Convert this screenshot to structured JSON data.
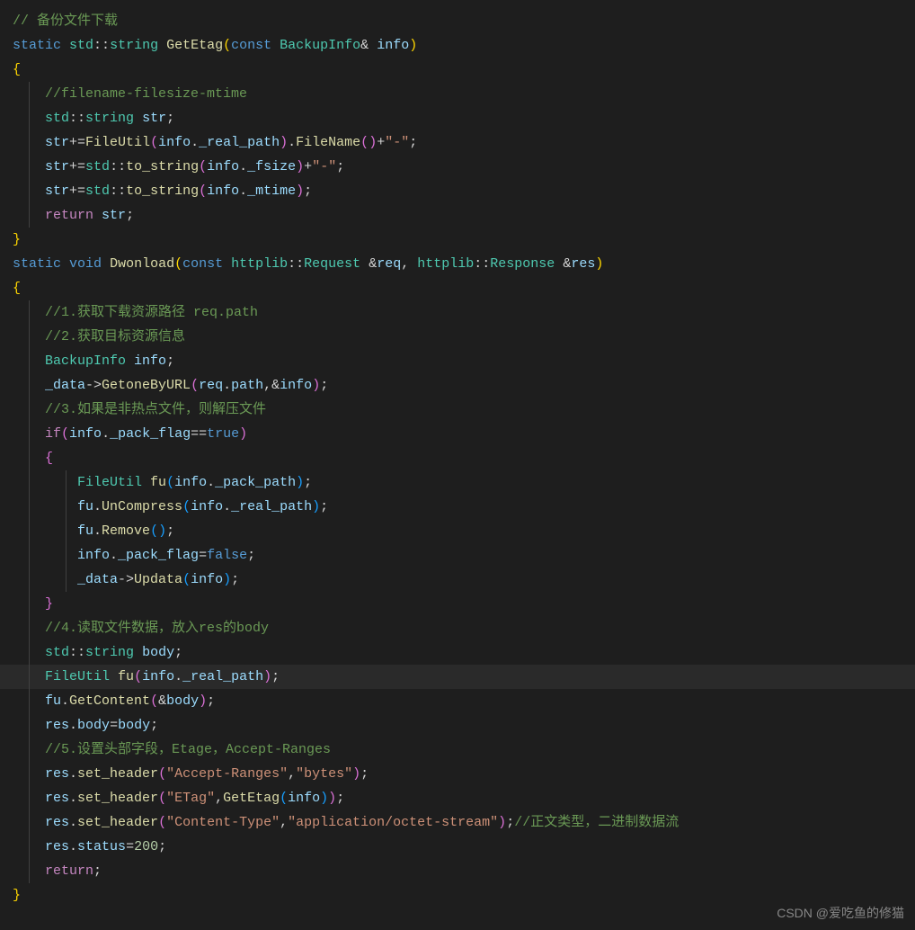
{
  "watermark": "CSDN @爱吃鱼的修猫",
  "lines": [
    {
      "indent": 0,
      "guides": [],
      "tokens": [
        {
          "t": "// ",
          "c": "c-comment"
        },
        {
          "t": "备份文件下载",
          "c": "c-comment"
        }
      ]
    },
    {
      "indent": 0,
      "guides": [],
      "tokens": [
        {
          "t": "static",
          "c": "c-keyword"
        },
        {
          "t": " ",
          "c": ""
        },
        {
          "t": "std",
          "c": "c-ns"
        },
        {
          "t": "::",
          "c": "c-punct"
        },
        {
          "t": "string",
          "c": "c-ns"
        },
        {
          "t": " ",
          "c": ""
        },
        {
          "t": "GetEtag",
          "c": "c-func"
        },
        {
          "t": "(",
          "c": "c-brace"
        },
        {
          "t": "const",
          "c": "c-keyword"
        },
        {
          "t": " ",
          "c": ""
        },
        {
          "t": "BackupInfo",
          "c": "c-type"
        },
        {
          "t": "&",
          "c": "c-op"
        },
        {
          "t": " ",
          "c": ""
        },
        {
          "t": "info",
          "c": "c-var"
        },
        {
          "t": ")",
          "c": "c-brace"
        }
      ]
    },
    {
      "indent": 0,
      "guides": [],
      "tokens": [
        {
          "t": "{",
          "c": "c-brace"
        }
      ]
    },
    {
      "indent": 1,
      "guides": [
        1
      ],
      "tokens": [
        {
          "t": "//filename-filesize-mtime",
          "c": "c-comment"
        }
      ]
    },
    {
      "indent": 1,
      "guides": [
        1
      ],
      "tokens": [
        {
          "t": "std",
          "c": "c-ns"
        },
        {
          "t": "::",
          "c": "c-punct"
        },
        {
          "t": "string",
          "c": "c-ns"
        },
        {
          "t": " ",
          "c": ""
        },
        {
          "t": "str",
          "c": "c-var"
        },
        {
          "t": ";",
          "c": "c-punct"
        }
      ]
    },
    {
      "indent": 1,
      "guides": [
        1
      ],
      "tokens": [
        {
          "t": "str",
          "c": "c-var"
        },
        {
          "t": "+=",
          "c": "c-op"
        },
        {
          "t": "FileUtil",
          "c": "c-func"
        },
        {
          "t": "(",
          "c": "c-brace2"
        },
        {
          "t": "info",
          "c": "c-var"
        },
        {
          "t": ".",
          "c": "c-punct"
        },
        {
          "t": "_real_path",
          "c": "c-var"
        },
        {
          "t": ")",
          "c": "c-brace2"
        },
        {
          "t": ".",
          "c": "c-punct"
        },
        {
          "t": "FileName",
          "c": "c-func"
        },
        {
          "t": "(",
          "c": "c-brace2"
        },
        {
          "t": ")",
          "c": "c-brace2"
        },
        {
          "t": "+",
          "c": "c-op"
        },
        {
          "t": "\"-\"",
          "c": "c-string"
        },
        {
          "t": ";",
          "c": "c-punct"
        }
      ]
    },
    {
      "indent": 1,
      "guides": [
        1
      ],
      "tokens": [
        {
          "t": "str",
          "c": "c-var"
        },
        {
          "t": "+=",
          "c": "c-op"
        },
        {
          "t": "std",
          "c": "c-ns"
        },
        {
          "t": "::",
          "c": "c-punct"
        },
        {
          "t": "to_string",
          "c": "c-func"
        },
        {
          "t": "(",
          "c": "c-brace2"
        },
        {
          "t": "info",
          "c": "c-var"
        },
        {
          "t": ".",
          "c": "c-punct"
        },
        {
          "t": "_fsize",
          "c": "c-var"
        },
        {
          "t": ")",
          "c": "c-brace2"
        },
        {
          "t": "+",
          "c": "c-op"
        },
        {
          "t": "\"-\"",
          "c": "c-string"
        },
        {
          "t": ";",
          "c": "c-punct"
        }
      ]
    },
    {
      "indent": 1,
      "guides": [
        1
      ],
      "tokens": [
        {
          "t": "str",
          "c": "c-var"
        },
        {
          "t": "+=",
          "c": "c-op"
        },
        {
          "t": "std",
          "c": "c-ns"
        },
        {
          "t": "::",
          "c": "c-punct"
        },
        {
          "t": "to_string",
          "c": "c-func"
        },
        {
          "t": "(",
          "c": "c-brace2"
        },
        {
          "t": "info",
          "c": "c-var"
        },
        {
          "t": ".",
          "c": "c-punct"
        },
        {
          "t": "_mtime",
          "c": "c-var"
        },
        {
          "t": ")",
          "c": "c-brace2"
        },
        {
          "t": ";",
          "c": "c-punct"
        }
      ]
    },
    {
      "indent": 1,
      "guides": [
        1
      ],
      "tokens": [
        {
          "t": "return",
          "c": "c-ctrl"
        },
        {
          "t": " ",
          "c": ""
        },
        {
          "t": "str",
          "c": "c-var"
        },
        {
          "t": ";",
          "c": "c-punct"
        }
      ]
    },
    {
      "indent": 0,
      "guides": [],
      "tokens": [
        {
          "t": "}",
          "c": "c-brace"
        }
      ]
    },
    {
      "indent": 0,
      "guides": [],
      "tokens": [
        {
          "t": "static",
          "c": "c-keyword"
        },
        {
          "t": " ",
          "c": ""
        },
        {
          "t": "void",
          "c": "c-keyword"
        },
        {
          "t": " ",
          "c": ""
        },
        {
          "t": "Dwonload",
          "c": "c-func"
        },
        {
          "t": "(",
          "c": "c-brace"
        },
        {
          "t": "const",
          "c": "c-keyword"
        },
        {
          "t": " ",
          "c": ""
        },
        {
          "t": "httplib",
          "c": "c-ns"
        },
        {
          "t": "::",
          "c": "c-punct"
        },
        {
          "t": "Request",
          "c": "c-type"
        },
        {
          "t": " ",
          "c": ""
        },
        {
          "t": "&",
          "c": "c-op"
        },
        {
          "t": "req",
          "c": "c-var"
        },
        {
          "t": ",",
          "c": "c-punct"
        },
        {
          "t": " ",
          "c": ""
        },
        {
          "t": "httplib",
          "c": "c-ns"
        },
        {
          "t": "::",
          "c": "c-punct"
        },
        {
          "t": "Response",
          "c": "c-type"
        },
        {
          "t": " ",
          "c": ""
        },
        {
          "t": "&",
          "c": "c-op"
        },
        {
          "t": "res",
          "c": "c-var"
        },
        {
          "t": ")",
          "c": "c-brace"
        }
      ]
    },
    {
      "indent": 0,
      "guides": [],
      "tokens": [
        {
          "t": "{",
          "c": "c-brace"
        }
      ]
    },
    {
      "indent": 1,
      "guides": [
        1
      ],
      "tokens": [
        {
          "t": "//1.获取下载资源路径 req.path",
          "c": "c-comment"
        }
      ]
    },
    {
      "indent": 1,
      "guides": [
        1
      ],
      "tokens": [
        {
          "t": "//2.获取目标资源信息",
          "c": "c-comment"
        }
      ]
    },
    {
      "indent": 1,
      "guides": [
        1
      ],
      "tokens": [
        {
          "t": "BackupInfo",
          "c": "c-type"
        },
        {
          "t": " ",
          "c": ""
        },
        {
          "t": "info",
          "c": "c-var"
        },
        {
          "t": ";",
          "c": "c-punct"
        }
      ]
    },
    {
      "indent": 1,
      "guides": [
        1
      ],
      "tokens": [
        {
          "t": "_data",
          "c": "c-var"
        },
        {
          "t": "->",
          "c": "c-op"
        },
        {
          "t": "GetoneByURL",
          "c": "c-func"
        },
        {
          "t": "(",
          "c": "c-brace2"
        },
        {
          "t": "req",
          "c": "c-var"
        },
        {
          "t": ".",
          "c": "c-punct"
        },
        {
          "t": "path",
          "c": "c-var"
        },
        {
          "t": ",",
          "c": "c-punct"
        },
        {
          "t": "&",
          "c": "c-op"
        },
        {
          "t": "info",
          "c": "c-var"
        },
        {
          "t": ")",
          "c": "c-brace2"
        },
        {
          "t": ";",
          "c": "c-punct"
        }
      ]
    },
    {
      "indent": 1,
      "guides": [
        1
      ],
      "tokens": [
        {
          "t": "//3.如果是非热点文件，则解压文件",
          "c": "c-comment"
        }
      ]
    },
    {
      "indent": 1,
      "guides": [
        1
      ],
      "tokens": [
        {
          "t": "if",
          "c": "c-ctrl"
        },
        {
          "t": "(",
          "c": "c-brace2"
        },
        {
          "t": "info",
          "c": "c-var"
        },
        {
          "t": ".",
          "c": "c-punct"
        },
        {
          "t": "_pack_flag",
          "c": "c-var"
        },
        {
          "t": "==",
          "c": "c-op"
        },
        {
          "t": "true",
          "c": "c-keyword"
        },
        {
          "t": ")",
          "c": "c-brace2"
        }
      ]
    },
    {
      "indent": 1,
      "guides": [
        1
      ],
      "tokens": [
        {
          "t": "{",
          "c": "c-brace2"
        }
      ]
    },
    {
      "indent": 2,
      "guides": [
        1,
        2
      ],
      "tokens": [
        {
          "t": "FileUtil",
          "c": "c-type"
        },
        {
          "t": " ",
          "c": ""
        },
        {
          "t": "fu",
          "c": "c-func"
        },
        {
          "t": "(",
          "c": "c-brace3"
        },
        {
          "t": "info",
          "c": "c-var"
        },
        {
          "t": ".",
          "c": "c-punct"
        },
        {
          "t": "_pack_path",
          "c": "c-var"
        },
        {
          "t": ")",
          "c": "c-brace3"
        },
        {
          "t": ";",
          "c": "c-punct"
        }
      ]
    },
    {
      "indent": 2,
      "guides": [
        1,
        2
      ],
      "tokens": [
        {
          "t": "fu",
          "c": "c-var"
        },
        {
          "t": ".",
          "c": "c-punct"
        },
        {
          "t": "UnCompress",
          "c": "c-func"
        },
        {
          "t": "(",
          "c": "c-brace3"
        },
        {
          "t": "info",
          "c": "c-var"
        },
        {
          "t": ".",
          "c": "c-punct"
        },
        {
          "t": "_real_path",
          "c": "c-var"
        },
        {
          "t": ")",
          "c": "c-brace3"
        },
        {
          "t": ";",
          "c": "c-punct"
        }
      ]
    },
    {
      "indent": 2,
      "guides": [
        1,
        2
      ],
      "tokens": [
        {
          "t": "fu",
          "c": "c-var"
        },
        {
          "t": ".",
          "c": "c-punct"
        },
        {
          "t": "Remove",
          "c": "c-func"
        },
        {
          "t": "(",
          "c": "c-brace3"
        },
        {
          "t": ")",
          "c": "c-brace3"
        },
        {
          "t": ";",
          "c": "c-punct"
        }
      ]
    },
    {
      "indent": 2,
      "guides": [
        1,
        2
      ],
      "tokens": [
        {
          "t": "info",
          "c": "c-var"
        },
        {
          "t": ".",
          "c": "c-punct"
        },
        {
          "t": "_pack_flag",
          "c": "c-var"
        },
        {
          "t": "=",
          "c": "c-op"
        },
        {
          "t": "false",
          "c": "c-keyword"
        },
        {
          "t": ";",
          "c": "c-punct"
        }
      ]
    },
    {
      "indent": 2,
      "guides": [
        1,
        2
      ],
      "tokens": [
        {
          "t": "_data",
          "c": "c-var"
        },
        {
          "t": "->",
          "c": "c-op"
        },
        {
          "t": "Updata",
          "c": "c-func"
        },
        {
          "t": "(",
          "c": "c-brace3"
        },
        {
          "t": "info",
          "c": "c-var"
        },
        {
          "t": ")",
          "c": "c-brace3"
        },
        {
          "t": ";",
          "c": "c-punct"
        }
      ]
    },
    {
      "indent": 1,
      "guides": [
        1
      ],
      "tokens": [
        {
          "t": "}",
          "c": "c-brace2"
        }
      ]
    },
    {
      "indent": 1,
      "guides": [
        1
      ],
      "tokens": [
        {
          "t": "//4.读取文件数据，放入res的body",
          "c": "c-comment"
        }
      ]
    },
    {
      "indent": 1,
      "guides": [
        1
      ],
      "tokens": [
        {
          "t": "std",
          "c": "c-ns"
        },
        {
          "t": "::",
          "c": "c-punct"
        },
        {
          "t": "string",
          "c": "c-ns"
        },
        {
          "t": " ",
          "c": ""
        },
        {
          "t": "body",
          "c": "c-var"
        },
        {
          "t": ";",
          "c": "c-punct"
        }
      ]
    },
    {
      "indent": 1,
      "guides": [
        1
      ],
      "current": true,
      "tokens": [
        {
          "t": "FileUtil",
          "c": "c-type"
        },
        {
          "t": " ",
          "c": ""
        },
        {
          "t": "fu",
          "c": "c-func"
        },
        {
          "t": "(",
          "c": "c-brace2"
        },
        {
          "t": "info",
          "c": "c-var"
        },
        {
          "t": ".",
          "c": "c-punct"
        },
        {
          "t": "_real_path",
          "c": "c-var"
        },
        {
          "t": ")",
          "c": "c-brace2"
        },
        {
          "t": ";",
          "c": "c-punct"
        }
      ]
    },
    {
      "indent": 1,
      "guides": [
        1
      ],
      "tokens": [
        {
          "t": "fu",
          "c": "c-var"
        },
        {
          "t": ".",
          "c": "c-punct"
        },
        {
          "t": "GetContent",
          "c": "c-func"
        },
        {
          "t": "(",
          "c": "c-brace2"
        },
        {
          "t": "&",
          "c": "c-op"
        },
        {
          "t": "body",
          "c": "c-var"
        },
        {
          "t": ")",
          "c": "c-brace2"
        },
        {
          "t": ";",
          "c": "c-punct"
        }
      ]
    },
    {
      "indent": 1,
      "guides": [
        1
      ],
      "tokens": [
        {
          "t": "res",
          "c": "c-var"
        },
        {
          "t": ".",
          "c": "c-punct"
        },
        {
          "t": "body",
          "c": "c-var"
        },
        {
          "t": "=",
          "c": "c-op"
        },
        {
          "t": "body",
          "c": "c-var"
        },
        {
          "t": ";",
          "c": "c-punct"
        }
      ]
    },
    {
      "indent": 1,
      "guides": [
        1
      ],
      "tokens": [
        {
          "t": "//5.设置头部字段，Etage，Accept-Ranges",
          "c": "c-comment"
        }
      ]
    },
    {
      "indent": 1,
      "guides": [
        1
      ],
      "tokens": [
        {
          "t": "res",
          "c": "c-var"
        },
        {
          "t": ".",
          "c": "c-punct"
        },
        {
          "t": "set_header",
          "c": "c-func"
        },
        {
          "t": "(",
          "c": "c-brace2"
        },
        {
          "t": "\"Accept-Ranges\"",
          "c": "c-string"
        },
        {
          "t": ",",
          "c": "c-punct"
        },
        {
          "t": "\"bytes\"",
          "c": "c-string"
        },
        {
          "t": ")",
          "c": "c-brace2"
        },
        {
          "t": ";",
          "c": "c-punct"
        }
      ]
    },
    {
      "indent": 1,
      "guides": [
        1
      ],
      "tokens": [
        {
          "t": "res",
          "c": "c-var"
        },
        {
          "t": ".",
          "c": "c-punct"
        },
        {
          "t": "set_header",
          "c": "c-func"
        },
        {
          "t": "(",
          "c": "c-brace2"
        },
        {
          "t": "\"ETag\"",
          "c": "c-string"
        },
        {
          "t": ",",
          "c": "c-punct"
        },
        {
          "t": "GetEtag",
          "c": "c-func"
        },
        {
          "t": "(",
          "c": "c-brace3"
        },
        {
          "t": "info",
          "c": "c-var"
        },
        {
          "t": ")",
          "c": "c-brace3"
        },
        {
          "t": ")",
          "c": "c-brace2"
        },
        {
          "t": ";",
          "c": "c-punct"
        }
      ]
    },
    {
      "indent": 1,
      "guides": [
        1
      ],
      "tokens": [
        {
          "t": "res",
          "c": "c-var"
        },
        {
          "t": ".",
          "c": "c-punct"
        },
        {
          "t": "set_header",
          "c": "c-func"
        },
        {
          "t": "(",
          "c": "c-brace2"
        },
        {
          "t": "\"Content-Type\"",
          "c": "c-string"
        },
        {
          "t": ",",
          "c": "c-punct"
        },
        {
          "t": "\"application/octet-stream\"",
          "c": "c-string"
        },
        {
          "t": ")",
          "c": "c-brace2"
        },
        {
          "t": ";",
          "c": "c-punct"
        },
        {
          "t": "//正文类型，二进制数据流",
          "c": "c-comment"
        }
      ]
    },
    {
      "indent": 1,
      "guides": [
        1
      ],
      "tokens": [
        {
          "t": "res",
          "c": "c-var"
        },
        {
          "t": ".",
          "c": "c-punct"
        },
        {
          "t": "status",
          "c": "c-var"
        },
        {
          "t": "=",
          "c": "c-op"
        },
        {
          "t": "200",
          "c": "c-num"
        },
        {
          "t": ";",
          "c": "c-punct"
        }
      ]
    },
    {
      "indent": 1,
      "guides": [
        1
      ],
      "tokens": [
        {
          "t": "return",
          "c": "c-ctrl"
        },
        {
          "t": ";",
          "c": "c-punct"
        }
      ]
    },
    {
      "indent": 0,
      "guides": [],
      "tokens": [
        {
          "t": "}",
          "c": "c-brace"
        }
      ]
    }
  ]
}
